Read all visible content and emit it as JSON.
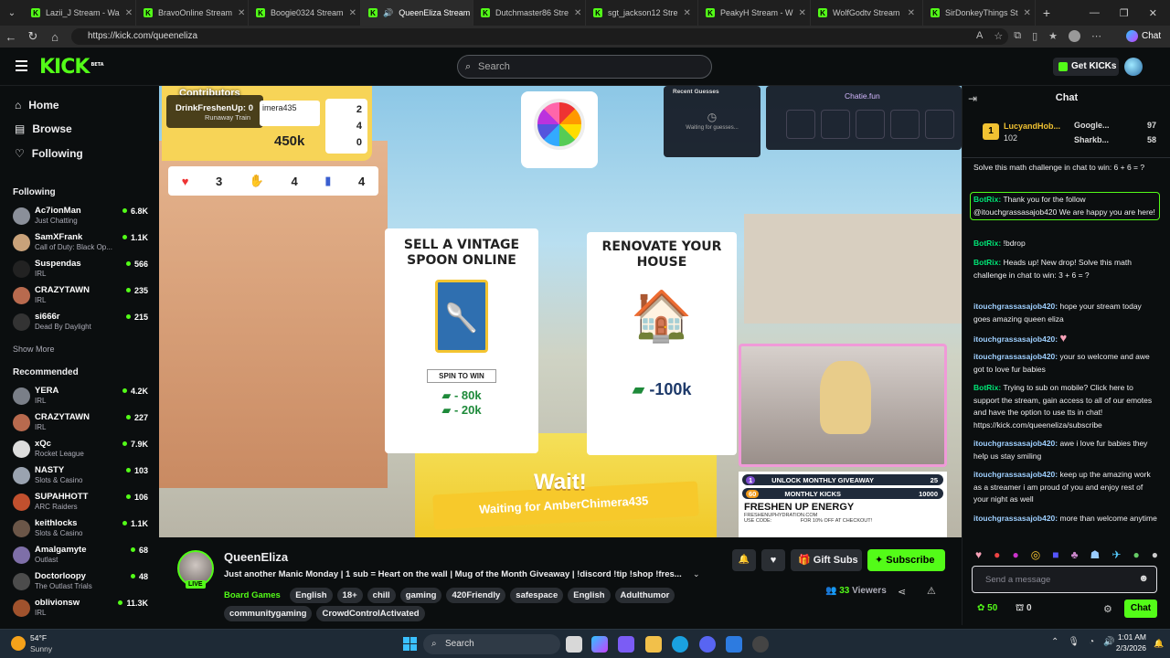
{
  "browser": {
    "tabs": [
      {
        "label": "Lazii_J Stream - Wa"
      },
      {
        "label": "BravoOnline Stream"
      },
      {
        "label": "Boogie0324 Stream"
      },
      {
        "label": "QueenEliza Stream"
      },
      {
        "label": "Dutchmaster86 Stre"
      },
      {
        "label": "sgt_jackson12 Stre"
      },
      {
        "label": "PeakyH Stream - W"
      },
      {
        "label": "WolfGodtv Stream"
      },
      {
        "label": "SirDonkeyThings St"
      }
    ],
    "active_tab_index": 3,
    "url": "https://kick.com/queeneliza",
    "chat_button": "Chat"
  },
  "header": {
    "logo": "KICK",
    "logo_badge": "BETA",
    "search_placeholder": "Search",
    "get_kicks": "Get KICKs"
  },
  "sidebar": {
    "nav": [
      {
        "label": "Home",
        "icon": "home-icon"
      },
      {
        "label": "Browse",
        "icon": "browse-icon"
      },
      {
        "label": "Following",
        "icon": "heart-icon"
      }
    ],
    "following_title": "Following",
    "following": [
      {
        "name": "Ac7ionMan",
        "category": "Just Chatting",
        "viewers": "6.8K"
      },
      {
        "name": "SamXFrank",
        "category": "Call of Duty: Black Op...",
        "viewers": "1.1K"
      },
      {
        "name": "Suspendas",
        "category": "IRL",
        "viewers": "566"
      },
      {
        "name": "CRAZYTAWN",
        "category": "IRL",
        "viewers": "235"
      },
      {
        "name": "si666r",
        "category": "Dead By Daylight",
        "viewers": "215"
      }
    ],
    "show_more": "Show More",
    "recommended_title": "Recommended",
    "recommended": [
      {
        "name": "YERA",
        "category": "IRL",
        "viewers": "4.2K"
      },
      {
        "name": "CRAZYTAWN",
        "category": "IRL",
        "viewers": "227"
      },
      {
        "name": "xQc",
        "category": "Rocket League",
        "viewers": "7.9K"
      },
      {
        "name": "NASTY",
        "category": "Slots & Casino",
        "viewers": "103"
      },
      {
        "name": "SUPAHHOTT",
        "category": "ARC Raiders",
        "viewers": "106"
      },
      {
        "name": "keithlocks",
        "category": "Slots & Casino",
        "viewers": "1.1K"
      },
      {
        "name": "Amalgamyte",
        "category": "Outlast",
        "viewers": "68"
      },
      {
        "name": "Doctorloopy",
        "category": "The Outlast Trials",
        "viewers": "48"
      },
      {
        "name": "oblivionsw",
        "category": "IRL",
        "viewers": "11.3K"
      }
    ]
  },
  "video": {
    "contributors_label": "Contributors",
    "contributor_name": "DrinkFreshenUp: 0",
    "contributor_sub": "Runaway Train",
    "player_tag": "imera435",
    "money": "450k",
    "counts": [
      "2",
      "4",
      "0"
    ],
    "bottom_counts": [
      "3",
      "4",
      "4"
    ],
    "recent_guesses_title": "Recent Guesses",
    "waiting_guesses": "Waiting for guesses...",
    "chatie": "Chatie.fun",
    "card1_title": "SELL A VINTAGE SPOON ONLINE",
    "spin_to_win": "SPIN TO WIN",
    "spin_values": [
      "80k",
      "20k"
    ],
    "card2_title": "RENOVATE YOUR HOUSE",
    "card2_value": "-100k",
    "wait_text": "Wait!",
    "waiting_for": "Waiting for AmberChimera435",
    "giveaway_rows": [
      {
        "num": "1",
        "label": "UNLOCK MONTHLY GIVEAWAY",
        "goal": "25"
      },
      {
        "num": "60",
        "label": "MONTHLY KICKS",
        "goal": "10000"
      }
    ],
    "sponsor": "FRESHEN UP ENERGY",
    "sponsor_url": "FRESHENUPHYDRATION.COM",
    "sponsor_code": "USE CODE:",
    "sponsor_off": "FOR 10% OFF AT CHECKOUT!"
  },
  "stream": {
    "name": "QueenEliza",
    "live_badge": "LIVE",
    "title": "Just another Manic Monday | 1 sub = Heart on the wall  | Mug of the Month Giveaway |  !discord !tip !shop !fres...",
    "category": "Board Games",
    "tags": [
      "English",
      "18+",
      "chill",
      "gaming",
      "420Friendly",
      "safespace",
      "English",
      "Adulthumor",
      "communitygaming",
      "CrowdControlActivated"
    ],
    "gift_subs": "Gift Subs",
    "subscribe": "Subscribe",
    "viewers": "33",
    "viewers_label": "Viewers"
  },
  "chat": {
    "title": "Chat",
    "leaderboard": [
      {
        "name": "LucyandHob...",
        "value": "102",
        "rank": "1"
      },
      {
        "name": "Google...",
        "value": "97"
      },
      {
        "name": "Sharkb...",
        "value": "58"
      }
    ],
    "messages": [
      {
        "user": "",
        "text": "Solve this math challenge in chat to win: 6 + 6 = ?"
      },
      {
        "user": "BotRix:",
        "text": "Thank you for the follow @itouchgrassasajob420 We are happy you are here!",
        "bot": true
      },
      {
        "user": "BotRix:",
        "text": "!bdrop",
        "bot": true
      },
      {
        "user": "BotRix:",
        "text": "Heads up! New drop! Solve this math challenge in chat to win: 3 + 6 = ?",
        "bot": true
      },
      {
        "user": "itouchgrassasajob420:",
        "text": "hope your stream today goes amazing queen eliza"
      },
      {
        "user": "itouchgrassasajob420:",
        "text": "♥"
      },
      {
        "user": "itouchgrassasajob420:",
        "text": "your so welcome and awe got to love fur babies"
      },
      {
        "user": "BotRix:",
        "text": "Trying to sub on mobile? Click here to support the stream, gain access to all of our emotes and have the option to use tts in chat! https://kick.com/queeneliza/subscribe",
        "bot": true
      },
      {
        "user": "itouchgrassasajob420:",
        "text": "awe i love fur babies they help us stay smiling"
      },
      {
        "user": "itouchgrassasajob420:",
        "text": "keep up the amazing work as a streamer i am proud of you and enjoy rest of your night as well"
      },
      {
        "user": "itouchgrassasajob420:",
        "text": "more than welcome anytime"
      }
    ],
    "input_placeholder": "Send a message",
    "points": "50",
    "chests": "0",
    "send": "Chat"
  },
  "taskbar": {
    "weather_temp": "54°F",
    "weather_desc": "Sunny",
    "search": "Search",
    "time": "1:01 AM",
    "date": "2/3/2026"
  }
}
